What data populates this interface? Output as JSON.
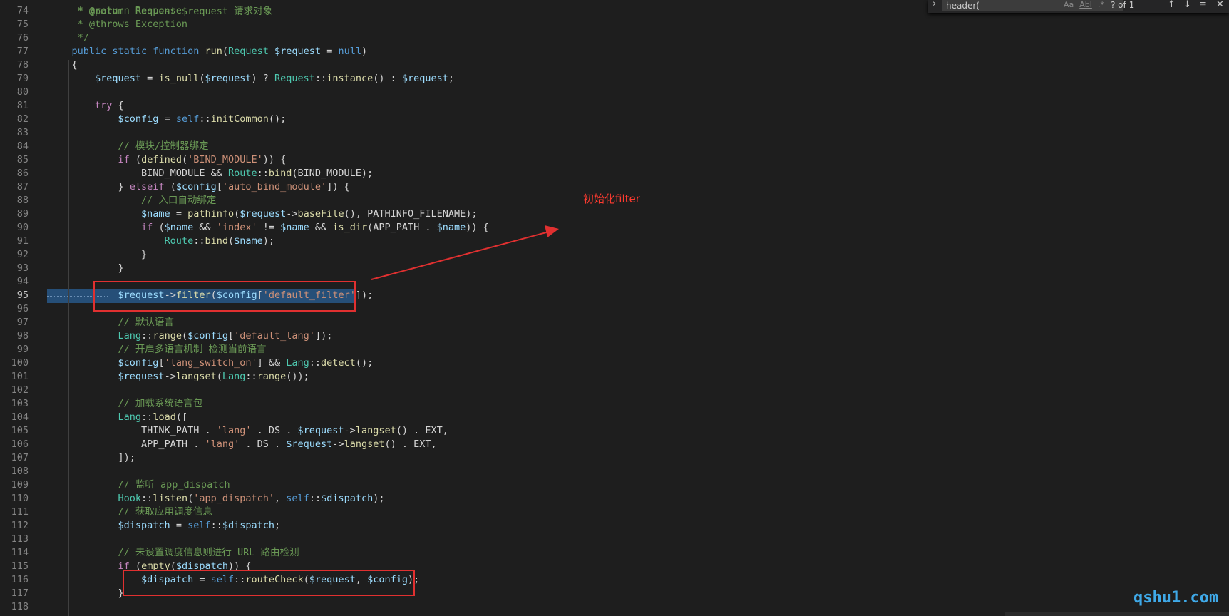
{
  "find": {
    "toggle_icon": "chevron-right-icon",
    "query": "header(",
    "match_case": "Aa",
    "whole_word": "Abl",
    "regex": ".*",
    "count": "? of 1",
    "prev_icon": "arrow-up-icon",
    "next_icon": "arrow-down-icon",
    "selection_icon": "list-icon",
    "close_icon": "close-icon"
  },
  "annotation": {
    "text": "初始化filter",
    "color": "#ff3b30"
  },
  "watermark": {
    "text": "qshu1.com",
    "color": "#3fa9e8"
  },
  "editor": {
    "current_line": "95",
    "lines": [
      {
        "n": "74",
        "t": [
          [
            "c",
            "     * @return Response"
          ]
        ]
      },
      {
        "n": "75",
        "t": [
          [
            "c",
            "     * @throws Exception"
          ]
        ]
      },
      {
        "n": "76",
        "t": [
          [
            "c",
            "     */"
          ]
        ]
      },
      {
        "n": "77",
        "t": [
          [
            "k",
            "    public static function "
          ],
          [
            "f",
            "run"
          ],
          [
            "p",
            "("
          ],
          [
            "t",
            "Request"
          ],
          [
            "p",
            " "
          ],
          [
            "v",
            "$request"
          ],
          [
            "p",
            " = "
          ],
          [
            "k",
            "null"
          ],
          [
            "p",
            ")"
          ]
        ]
      },
      {
        "n": "78",
        "t": [
          [
            "p",
            "    {"
          ]
        ]
      },
      {
        "n": "79",
        "t": [
          [
            "v",
            "        $request"
          ],
          [
            "p",
            " = "
          ],
          [
            "f",
            "is_null"
          ],
          [
            "p",
            "("
          ],
          [
            "v",
            "$request"
          ],
          [
            "p",
            ") ? "
          ],
          [
            "t",
            "Request"
          ],
          [
            "p",
            "::"
          ],
          [
            "f",
            "instance"
          ],
          [
            "p",
            "() : "
          ],
          [
            "v",
            "$request"
          ],
          [
            "p",
            ";"
          ]
        ]
      },
      {
        "n": "80",
        "t": []
      },
      {
        "n": "81",
        "t": [
          [
            "kw",
            "        try"
          ],
          [
            "p",
            " {"
          ]
        ]
      },
      {
        "n": "82",
        "t": [
          [
            "v",
            "            $config"
          ],
          [
            "p",
            " = "
          ],
          [
            "k",
            "self"
          ],
          [
            "p",
            "::"
          ],
          [
            "f",
            "initCommon"
          ],
          [
            "p",
            "();"
          ]
        ]
      },
      {
        "n": "83",
        "t": []
      },
      {
        "n": "84",
        "t": [
          [
            "c",
            "            // 模块/控制器绑定"
          ]
        ]
      },
      {
        "n": "85",
        "t": [
          [
            "kw",
            "            if"
          ],
          [
            "p",
            " ("
          ],
          [
            "f",
            "defined"
          ],
          [
            "p",
            "("
          ],
          [
            "s",
            "'BIND_MODULE'"
          ],
          [
            "p",
            ")) {"
          ]
        ]
      },
      {
        "n": "86",
        "t": [
          [
            "p",
            "                BIND_MODULE && "
          ],
          [
            "t",
            "Route"
          ],
          [
            "p",
            "::"
          ],
          [
            "f",
            "bind"
          ],
          [
            "p",
            "(BIND_MODULE);"
          ]
        ]
      },
      {
        "n": "87",
        "t": [
          [
            "p",
            "            } "
          ],
          [
            "kw",
            "elseif"
          ],
          [
            "p",
            " ("
          ],
          [
            "v",
            "$config"
          ],
          [
            "p",
            "["
          ],
          [
            "s",
            "'auto_bind_module'"
          ],
          [
            "p",
            "]) {"
          ]
        ]
      },
      {
        "n": "88",
        "t": [
          [
            "c",
            "                // 入口自动绑定"
          ]
        ]
      },
      {
        "n": "89",
        "t": [
          [
            "v",
            "                $name"
          ],
          [
            "p",
            " = "
          ],
          [
            "f",
            "pathinfo"
          ],
          [
            "p",
            "("
          ],
          [
            "v",
            "$request"
          ],
          [
            "p",
            "->"
          ],
          [
            "f",
            "baseFile"
          ],
          [
            "p",
            "(), PATHINFO_FILENAME);"
          ]
        ]
      },
      {
        "n": "90",
        "t": [
          [
            "kw",
            "                if"
          ],
          [
            "p",
            " ("
          ],
          [
            "v",
            "$name"
          ],
          [
            "p",
            " && "
          ],
          [
            "s",
            "'index'"
          ],
          [
            "p",
            " != "
          ],
          [
            "v",
            "$name"
          ],
          [
            "p",
            " && "
          ],
          [
            "f",
            "is_dir"
          ],
          [
            "p",
            "(APP_PATH . "
          ],
          [
            "v",
            "$name"
          ],
          [
            "p",
            ")) {"
          ]
        ]
      },
      {
        "n": "91",
        "t": [
          [
            "t",
            "                    Route"
          ],
          [
            "p",
            "::"
          ],
          [
            "f",
            "bind"
          ],
          [
            "p",
            "("
          ],
          [
            "v",
            "$name"
          ],
          [
            "p",
            ");"
          ]
        ]
      },
      {
        "n": "92",
        "t": [
          [
            "p",
            "                }"
          ]
        ]
      },
      {
        "n": "93",
        "t": [
          [
            "p",
            "            }"
          ]
        ]
      },
      {
        "n": "94",
        "t": []
      },
      {
        "n": "95",
        "t": [
          [
            "v",
            "            $request"
          ],
          [
            "p",
            "->"
          ],
          [
            "f",
            "filter"
          ],
          [
            "p",
            "("
          ],
          [
            "v",
            "$config"
          ],
          [
            "p",
            "["
          ],
          [
            "s",
            "'default_filter'"
          ],
          [
            "p",
            "]);"
          ]
        ]
      },
      {
        "n": "96",
        "t": []
      },
      {
        "n": "97",
        "t": [
          [
            "c",
            "            // 默认语言"
          ]
        ]
      },
      {
        "n": "98",
        "t": [
          [
            "t",
            "            Lang"
          ],
          [
            "p",
            "::"
          ],
          [
            "f",
            "range"
          ],
          [
            "p",
            "("
          ],
          [
            "v",
            "$config"
          ],
          [
            "p",
            "["
          ],
          [
            "s",
            "'default_lang'"
          ],
          [
            "p",
            "]);"
          ]
        ]
      },
      {
        "n": "99",
        "t": [
          [
            "c",
            "            // 开启多语言机制 检测当前语言"
          ]
        ]
      },
      {
        "n": "100",
        "t": [
          [
            "v",
            "            $config"
          ],
          [
            "p",
            "["
          ],
          [
            "s",
            "'lang_switch_on'"
          ],
          [
            "p",
            "] && "
          ],
          [
            "t",
            "Lang"
          ],
          [
            "p",
            "::"
          ],
          [
            "f",
            "detect"
          ],
          [
            "p",
            "();"
          ]
        ]
      },
      {
        "n": "101",
        "t": [
          [
            "v",
            "            $request"
          ],
          [
            "p",
            "->"
          ],
          [
            "f",
            "langset"
          ],
          [
            "p",
            "("
          ],
          [
            "t",
            "Lang"
          ],
          [
            "p",
            "::"
          ],
          [
            "f",
            "range"
          ],
          [
            "p",
            "());"
          ]
        ]
      },
      {
        "n": "102",
        "t": []
      },
      {
        "n": "103",
        "t": [
          [
            "c",
            "            // 加载系统语言包"
          ]
        ]
      },
      {
        "n": "104",
        "t": [
          [
            "t",
            "            Lang"
          ],
          [
            "p",
            "::"
          ],
          [
            "f",
            "load"
          ],
          [
            "p",
            "(["
          ]
        ]
      },
      {
        "n": "105",
        "t": [
          [
            "p",
            "                THINK_PATH . "
          ],
          [
            "s",
            "'lang'"
          ],
          [
            "p",
            " . DS . "
          ],
          [
            "v",
            "$request"
          ],
          [
            "p",
            "->"
          ],
          [
            "f",
            "langset"
          ],
          [
            "p",
            "() . EXT,"
          ]
        ]
      },
      {
        "n": "106",
        "t": [
          [
            "p",
            "                APP_PATH . "
          ],
          [
            "s",
            "'lang'"
          ],
          [
            "p",
            " . DS . "
          ],
          [
            "v",
            "$request"
          ],
          [
            "p",
            "->"
          ],
          [
            "f",
            "langset"
          ],
          [
            "p",
            "() . EXT,"
          ]
        ]
      },
      {
        "n": "107",
        "t": [
          [
            "p",
            "            ]);"
          ]
        ]
      },
      {
        "n": "108",
        "t": []
      },
      {
        "n": "109",
        "t": [
          [
            "c",
            "            // 监听 app_dispatch"
          ]
        ]
      },
      {
        "n": "110",
        "t": [
          [
            "t",
            "            Hook"
          ],
          [
            "p",
            "::"
          ],
          [
            "f",
            "listen"
          ],
          [
            "p",
            "("
          ],
          [
            "s",
            "'app_dispatch'"
          ],
          [
            "p",
            ", "
          ],
          [
            "k",
            "self"
          ],
          [
            "p",
            "::"
          ],
          [
            "v",
            "$dispatch"
          ],
          [
            "p",
            ");"
          ]
        ]
      },
      {
        "n": "111",
        "t": [
          [
            "c",
            "            // 获取应用调度信息"
          ]
        ]
      },
      {
        "n": "112",
        "t": [
          [
            "v",
            "            $dispatch"
          ],
          [
            "p",
            " = "
          ],
          [
            "k",
            "self"
          ],
          [
            "p",
            "::"
          ],
          [
            "v",
            "$dispatch"
          ],
          [
            "p",
            ";"
          ]
        ]
      },
      {
        "n": "113",
        "t": []
      },
      {
        "n": "114",
        "t": [
          [
            "c",
            "            // 未设置调度信息则进行 URL 路由检测"
          ]
        ]
      },
      {
        "n": "115",
        "t": [
          [
            "kw",
            "            if"
          ],
          [
            "p",
            " ("
          ],
          [
            "f",
            "empty"
          ],
          [
            "p",
            "("
          ],
          [
            "v",
            "$dispatch"
          ],
          [
            "p",
            ")) {"
          ]
        ]
      },
      {
        "n": "116",
        "t": [
          [
            "v",
            "                $dispatch"
          ],
          [
            "p",
            " = "
          ],
          [
            "k",
            "self"
          ],
          [
            "p",
            "::"
          ],
          [
            "f",
            "routeCheck"
          ],
          [
            "p",
            "("
          ],
          [
            "v",
            "$request"
          ],
          [
            "p",
            ", "
          ],
          [
            "v",
            "$config"
          ],
          [
            "p",
            ");"
          ]
        ]
      },
      {
        "n": "117",
        "t": [
          [
            "p",
            "            }"
          ]
        ]
      },
      {
        "n": "118",
        "t": []
      }
    ]
  }
}
